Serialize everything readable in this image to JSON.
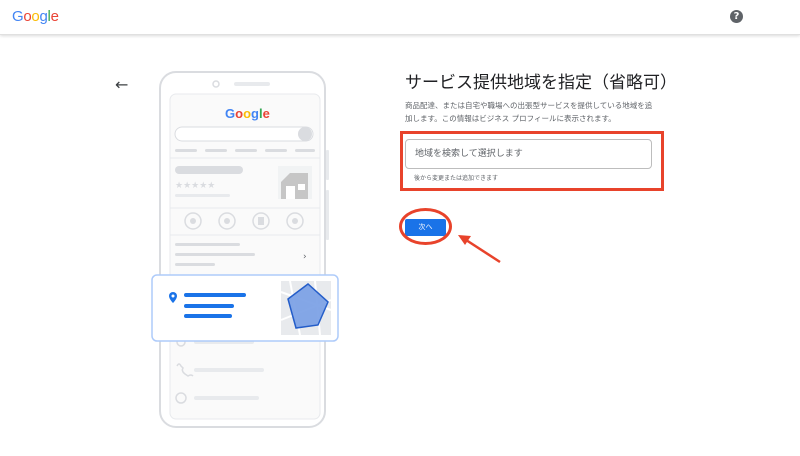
{
  "header": {
    "logo_letters": [
      {
        "ch": "G",
        "color": "#4285f4"
      },
      {
        "ch": "o",
        "color": "#ea4335"
      },
      {
        "ch": "o",
        "color": "#fbbc05"
      },
      {
        "ch": "g",
        "color": "#4285f4"
      },
      {
        "ch": "l",
        "color": "#34a853"
      },
      {
        "ch": "e",
        "color": "#ea4335"
      }
    ],
    "help_label": "?",
    "help_icon": "help-circle-icon"
  },
  "back_icon": "←",
  "illustration": {
    "brand": "Google",
    "stars": "★★★★★"
  },
  "form": {
    "title": "サービス提供地域を指定（省略可）",
    "description": "商品配達、または自宅や職場への出張型サービスを提供している地域を追加します。この情報はビジネス プロフィールに表示されます。",
    "search_placeholder": "地域を検索して選択します",
    "hint": "後から変更または追加できます",
    "next_label": "次へ"
  },
  "colors": {
    "accent": "#1a73e8",
    "annotation": "#e8432b",
    "map_fill": "#7ea3e6"
  }
}
